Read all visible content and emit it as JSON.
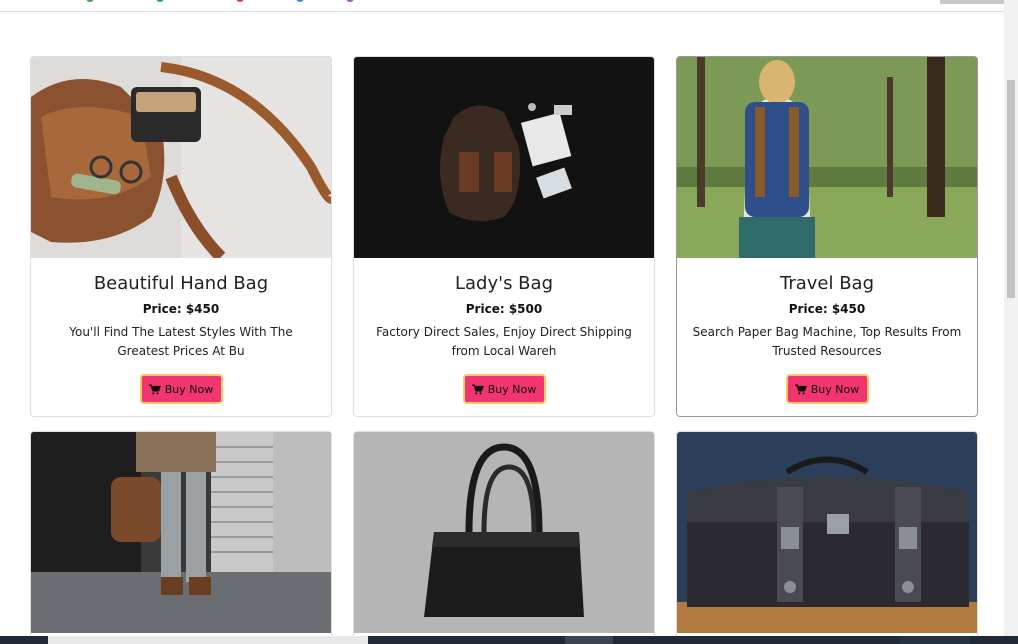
{
  "products": [
    {
      "name": "Beautiful Hand Bag",
      "price": "Price: $450",
      "description": "You'll Find The Latest Styles With The Greatest Prices At Bu",
      "button": "Buy Now"
    },
    {
      "name": "Lady's Bag",
      "price": "Price: $500",
      "description": "Factory Direct Sales, Enjoy Direct Shipping from Local Wareh",
      "button": "Buy Now"
    },
    {
      "name": "Travel Bag",
      "price": "Price: $450",
      "description": "Search Paper Bag Machine, Top Results From Trusted Resources",
      "button": "Buy Now"
    }
  ],
  "colors": {
    "buy_button_bg": "#f0356f",
    "buy_button_border": "#f4c96a"
  },
  "icons": {
    "buy_button": "shopping-cart-icon"
  }
}
